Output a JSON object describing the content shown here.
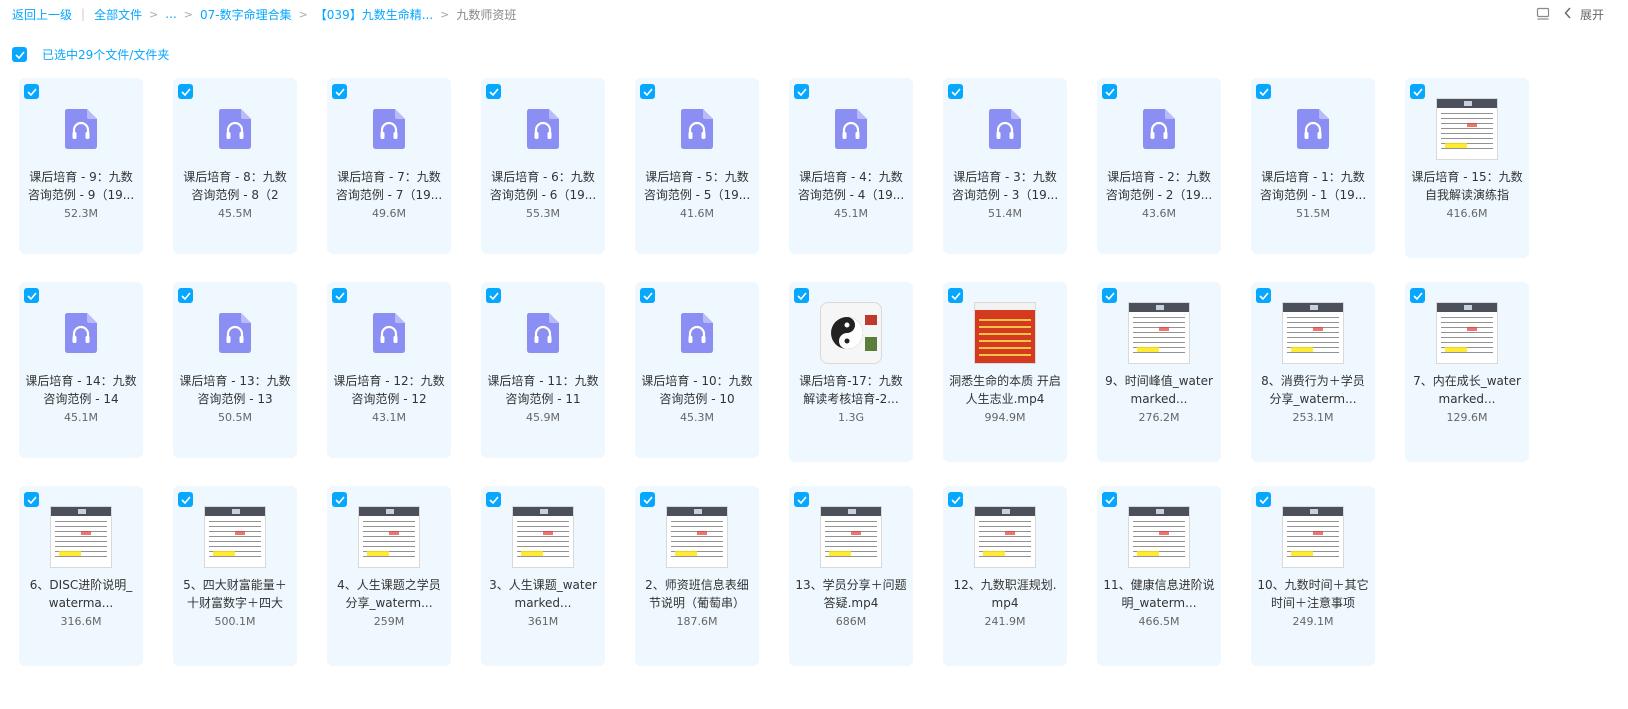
{
  "breadcrumb": {
    "back": "返回上一级",
    "all_files": "全部文件",
    "ellipsis": "...",
    "folder1": "07-数字命理合集",
    "folder2": "【039】九数生命精...",
    "current": "九数师资班"
  },
  "toolbar": {
    "list_icon": "list-view-icon",
    "expand_label": "展开"
  },
  "selection": {
    "label": "已选中29个文件/文件夹"
  },
  "colors": {
    "accent": "#06a7ff",
    "card_bg": "#eef8fe",
    "audio_icon": "#8b8ef3"
  },
  "files": [
    {
      "name": "课后培育 - 9：九数咨询范例 - 9（19...",
      "size": "52.3M",
      "type": "audio"
    },
    {
      "name": "课后培育 - 8：九数咨询范例 - 8（2",
      "size": "45.5M",
      "type": "audio"
    },
    {
      "name": "课后培育 - 7：九数咨询范例 - 7（19...",
      "size": "49.6M",
      "type": "audio"
    },
    {
      "name": "课后培育 - 6：九数咨询范例 - 6（19...",
      "size": "55.3M",
      "type": "audio"
    },
    {
      "name": "课后培育 - 5：九数咨询范例 - 5（19...",
      "size": "41.6M",
      "type": "audio"
    },
    {
      "name": "课后培育 - 4：九数咨询范例 - 4（19...",
      "size": "45.1M",
      "type": "audio"
    },
    {
      "name": "课后培育 - 3：九数咨询范例 - 3（19...",
      "size": "51.4M",
      "type": "audio"
    },
    {
      "name": "课后培育 - 2：九数咨询范例 - 2（19...",
      "size": "43.6M",
      "type": "audio"
    },
    {
      "name": "课后培育 - 1：九数咨询范例 - 1（19...",
      "size": "51.5M",
      "type": "audio"
    },
    {
      "name": "课后培育 - 15：九数自我解读演练指",
      "size": "416.6M",
      "type": "video"
    },
    {
      "name": "课后培育 - 14：九数咨询范例 - 14",
      "size": "45.1M",
      "type": "audio"
    },
    {
      "name": "课后培育 - 13：九数咨询范例 - 13",
      "size": "50.5M",
      "type": "audio"
    },
    {
      "name": "课后培育 - 12：九数咨询范例 - 12",
      "size": "43.1M",
      "type": "audio"
    },
    {
      "name": "课后培育 - 11：九数咨询范例 - 11",
      "size": "45.9M",
      "type": "audio"
    },
    {
      "name": "课后培育 - 10：九数咨询范例 - 10",
      "size": "45.3M",
      "type": "audio"
    },
    {
      "name": "课后培育-17：九数解读考核培育-2...",
      "size": "1.3G",
      "type": "video-yin"
    },
    {
      "name": "洞悉生命的本质 开启人生志业.mp4",
      "size": "994.9M",
      "type": "video-red"
    },
    {
      "name": "9、时间峰值_watermarked...",
      "size": "276.2M",
      "type": "video"
    },
    {
      "name": "8、消费行为＋学员分享_waterm...",
      "size": "253.1M",
      "type": "video"
    },
    {
      "name": "7、内在成长_watermarked...",
      "size": "129.6M",
      "type": "video"
    },
    {
      "name": "6、DISC进阶说明_waterma...",
      "size": "316.6M",
      "type": "video"
    },
    {
      "name": "5、四大财富能量＋十财富数字＋四大",
      "size": "500.1M",
      "type": "video"
    },
    {
      "name": "4、人生课题之学员分享_waterm...",
      "size": "259M",
      "type": "video"
    },
    {
      "name": "3、人生课题_watermarked...",
      "size": "361M",
      "type": "video"
    },
    {
      "name": "2、师资班信息表细节说明（葡萄串）",
      "size": "187.6M",
      "type": "video"
    },
    {
      "name": "13、学员分享＋问题答疑.mp4",
      "size": "686M",
      "type": "video"
    },
    {
      "name": "12、九数职涯规划.mp4",
      "size": "241.9M",
      "type": "video"
    },
    {
      "name": "11、健康信息进阶说明_waterm...",
      "size": "466.5M",
      "type": "video"
    },
    {
      "name": "10、九数时间＋其它时间＋注意事项",
      "size": "249.1M",
      "type": "video"
    }
  ]
}
